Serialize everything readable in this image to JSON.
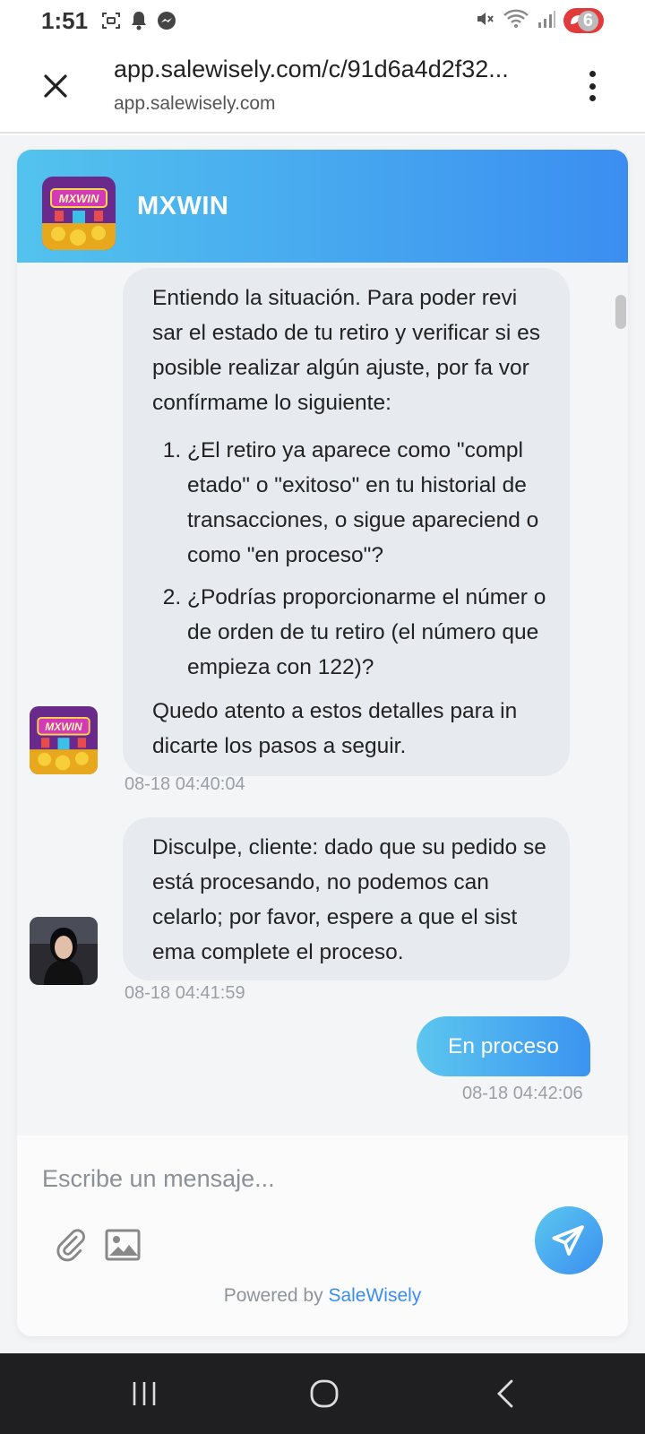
{
  "status_bar": {
    "time": "1:51",
    "battery_level": "6",
    "battery_color": "#e33b3b"
  },
  "browser": {
    "url": "app.salewisely.com/c/91d6a4d2f32...",
    "domain": "app.salewisely.com"
  },
  "chat": {
    "brand_name": "MXWIN",
    "header_gradient": [
      "#53c3ee",
      "#3b8ef0"
    ],
    "messages": [
      {
        "sender": "bot",
        "intro": "Entiendo la situación. Para poder revi sar el estado de tu retiro y verificar si es posible realizar algún ajuste, por fa vor confírmame lo siguiente:",
        "list": [
          "¿El retiro ya aparece como \"compl etado\" o \"exitoso\" en tu historial de transacciones, o sigue apareciend o como \"en proceso\"?",
          "¿Podrías proporcionarme el númer o de orden de tu retiro (el número que empieza con 122)?"
        ],
        "outro": "Quedo atento a estos detalles para in dicarte los pasos a seguir.",
        "time": "08-18 04:40:04"
      },
      {
        "sender": "agent",
        "text": "Disculpe, cliente: dado que su pedido se está procesando, no podemos can celarlo; por favor, espere a que el sist ema complete el proceso.",
        "time": "08-18 04:41:59"
      },
      {
        "sender": "user",
        "text": "En proceso",
        "time": "08-18 04:42:06"
      }
    ]
  },
  "composer": {
    "placeholder": "Escribe un mensaje...",
    "powered_prefix": "Powered by",
    "powered_brand": "SaleWisely"
  }
}
